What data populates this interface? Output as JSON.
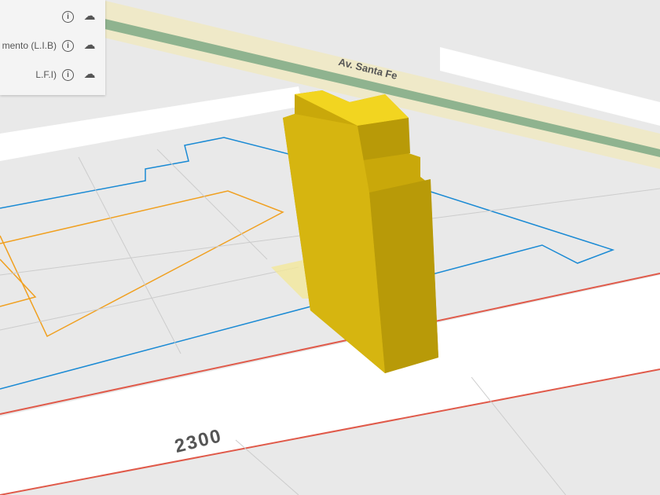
{
  "layers_panel": {
    "items": [
      {
        "label": "",
        "info_icon": "info-icon",
        "download_icon": "cloud-download-icon"
      },
      {
        "label": "mento (L.I.B)",
        "info_icon": "info-icon",
        "download_icon": "cloud-download-icon"
      },
      {
        "label": "L.F.I)",
        "info_icon": "info-icon",
        "download_icon": "cloud-download-icon"
      }
    ]
  },
  "map": {
    "street_labels": [
      "Av. Santa Fe",
      "2300"
    ],
    "colors": {
      "building": "#e8c40a",
      "avenue_median": "#8fb38f",
      "avenue": "#efe9c8",
      "lot_line_red": "#e05a4a",
      "line_blue": "#1a8ad4",
      "line_orange": "#f0a020"
    }
  }
}
